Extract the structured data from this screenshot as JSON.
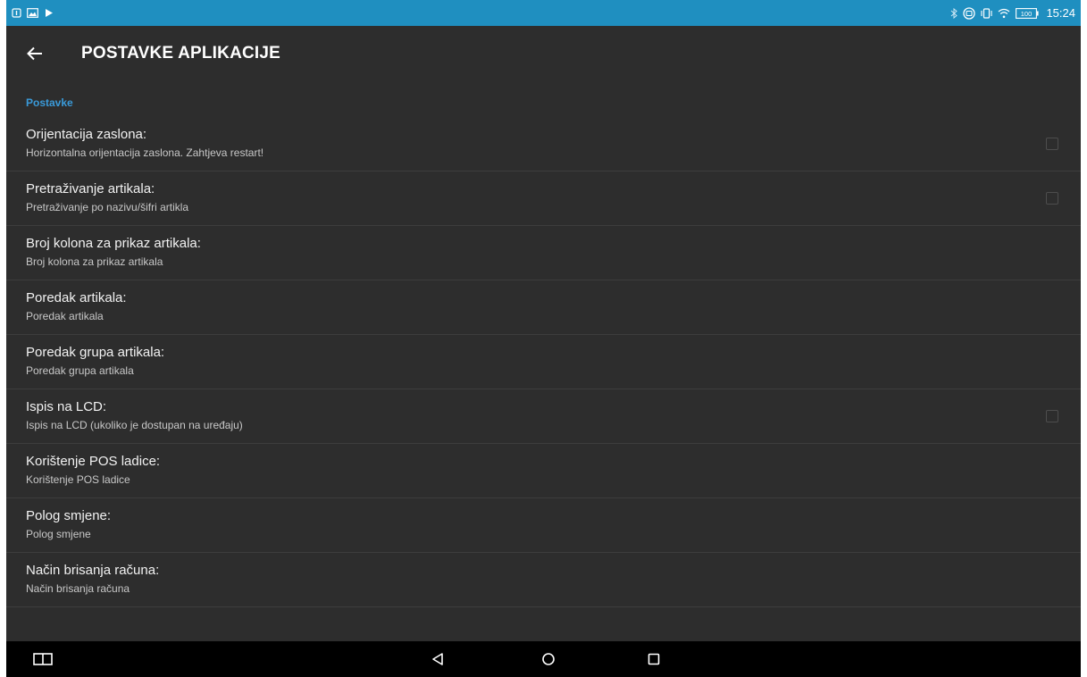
{
  "status_bar": {
    "time": "15:24",
    "battery": "100",
    "left_icons": [
      "notification-icon",
      "image-icon",
      "play-store-icon"
    ],
    "right_icons": [
      "bluetooth-icon",
      "sync-icon",
      "vibrate-icon",
      "wifi-icon",
      "battery-icon"
    ],
    "color": "#1f8fc0"
  },
  "app_bar": {
    "title": "POSTAVKE APLIKACIJE",
    "back_icon": "arrow-back-icon"
  },
  "section": {
    "title": "Postavke",
    "accent": "#3a9ad9"
  },
  "preferences": [
    {
      "title": "Orijentacija zaslona:",
      "summary": "Horizontalna orijentacija zaslona. Zahtjeva restart!",
      "checkbox": true,
      "checked": false
    },
    {
      "title": "Pretraživanje artikala:",
      "summary": "Pretraživanje po nazivu/šifri artikla",
      "checkbox": true,
      "checked": false
    },
    {
      "title": "Broj kolona za prikaz artikala:",
      "summary": "Broj kolona za prikaz artikala",
      "checkbox": false
    },
    {
      "title": "Poredak artikala:",
      "summary": "Poredak artikala",
      "checkbox": false
    },
    {
      "title": "Poredak grupa artikala:",
      "summary": "Poredak grupa artikala",
      "checkbox": false
    },
    {
      "title": "Ispis na LCD:",
      "summary": "Ispis na LCD (ukoliko je dostupan na uređaju)",
      "checkbox": true,
      "checked": false
    },
    {
      "title": "Korištenje POS ladice:",
      "summary": "Korištenje POS ladice",
      "checkbox": false
    },
    {
      "title": "Polog smjene:",
      "summary": "Polog smjene",
      "checkbox": false
    },
    {
      "title": "Način brisanja računa:",
      "summary": "Način brisanja računa",
      "checkbox": false
    }
  ],
  "nav_bar": {
    "buttons": [
      "recent-apps-split-icon",
      "back-triangle-icon",
      "home-circle-icon",
      "overview-square-icon"
    ]
  }
}
